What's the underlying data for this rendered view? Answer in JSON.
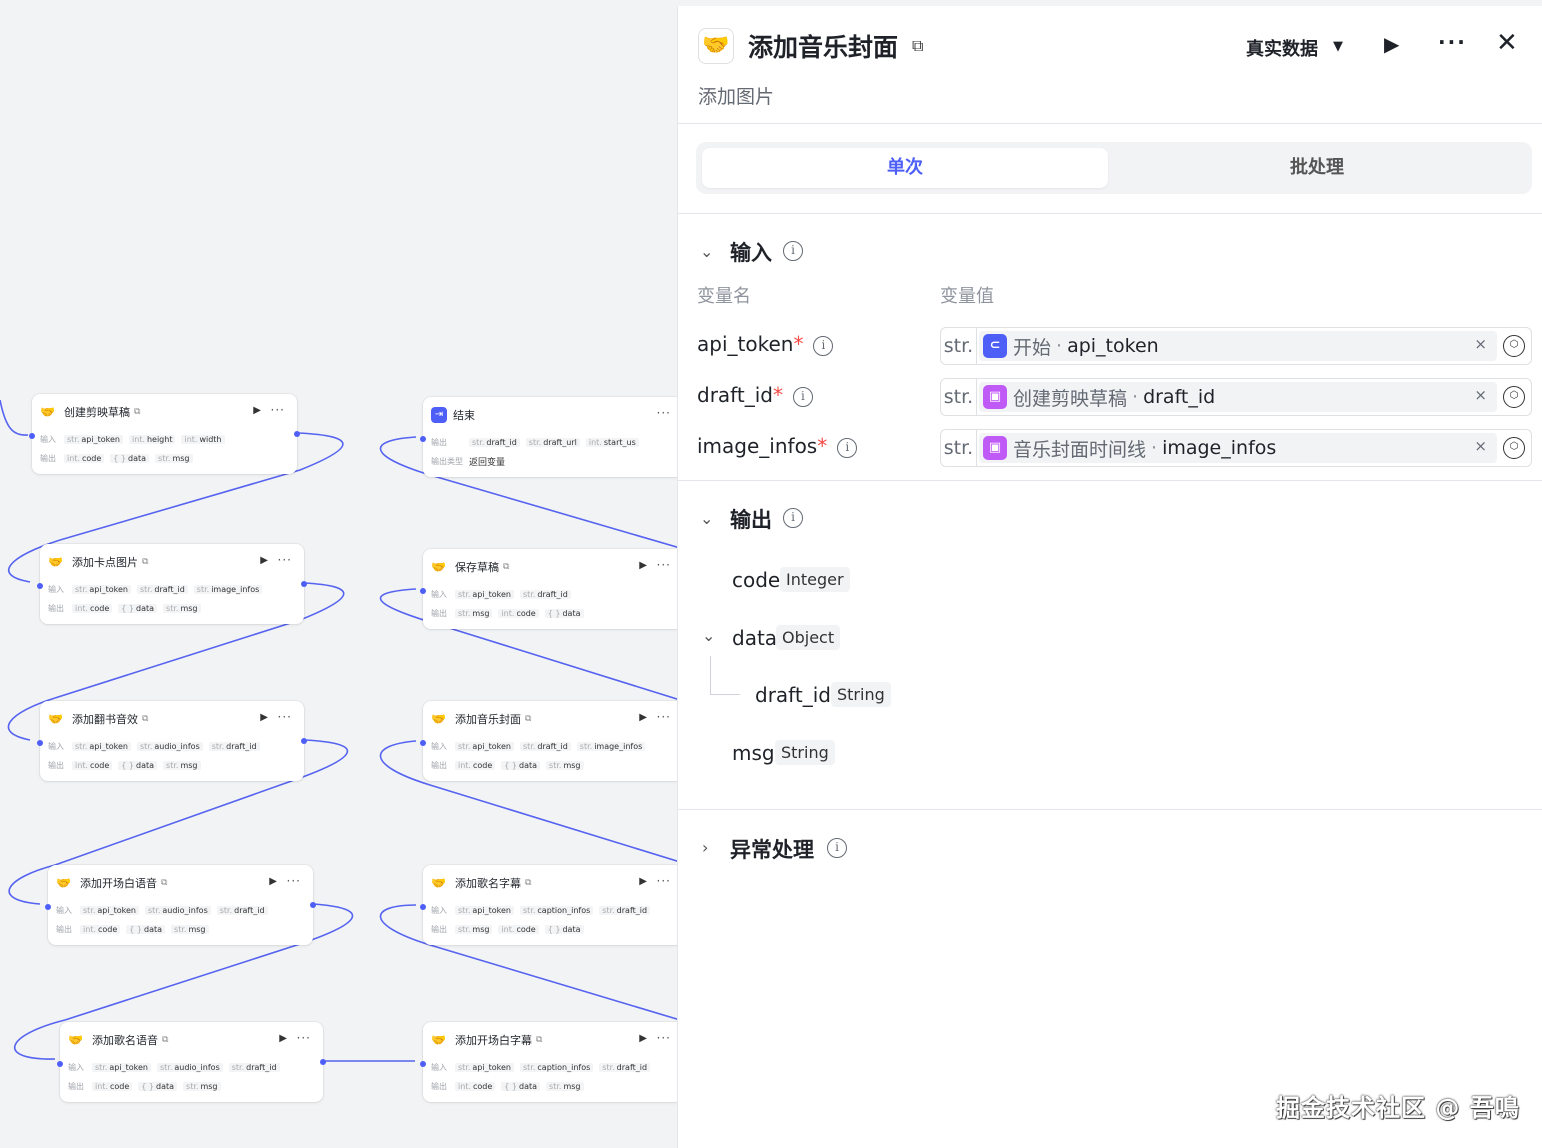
{
  "canvas": {
    "input_label": "输入",
    "output_label": "输出",
    "output_type_label": "输出类型",
    "nodes": [
      {
        "title": "创建剪映草稿",
        "inputs": [
          [
            "str.",
            "api_token"
          ],
          [
            "int.",
            "height"
          ],
          [
            "int.",
            "width"
          ]
        ],
        "outputs": [
          [
            "int.",
            "code"
          ],
          [
            "{ }",
            "data"
          ],
          [
            "str.",
            "msg"
          ]
        ]
      },
      {
        "title": "添加卡点图片",
        "inputs": [
          [
            "str.",
            "api_token"
          ],
          [
            "str.",
            "draft_id"
          ],
          [
            "str.",
            "image_infos"
          ]
        ],
        "outputs": [
          [
            "int.",
            "code"
          ],
          [
            "{ }",
            "data"
          ],
          [
            "str.",
            "msg"
          ]
        ]
      },
      {
        "title": "添加翻书音效",
        "inputs": [
          [
            "str.",
            "api_token"
          ],
          [
            "str.",
            "audio_infos"
          ],
          [
            "str.",
            "draft_id"
          ]
        ],
        "outputs": [
          [
            "int.",
            "code"
          ],
          [
            "{ }",
            "data"
          ],
          [
            "str.",
            "msg"
          ]
        ]
      },
      {
        "title": "添加开场白语音",
        "inputs": [
          [
            "str.",
            "api_token"
          ],
          [
            "str.",
            "audio_infos"
          ],
          [
            "str.",
            "draft_id"
          ]
        ],
        "outputs": [
          [
            "int.",
            "code"
          ],
          [
            "{ }",
            "data"
          ],
          [
            "str.",
            "msg"
          ]
        ]
      },
      {
        "title": "添加歌名语音",
        "inputs": [
          [
            "str.",
            "api_token"
          ],
          [
            "str.",
            "audio_infos"
          ],
          [
            "str.",
            "draft_id"
          ]
        ],
        "outputs": [
          [
            "int.",
            "code"
          ],
          [
            "{ }",
            "data"
          ],
          [
            "str.",
            "msg"
          ]
        ]
      },
      {
        "title": "结束",
        "inputs": [
          [
            "str.",
            "draft_id"
          ],
          [
            "str.",
            "draft_url"
          ],
          [
            "int.",
            "start_us"
          ]
        ],
        "return_text": "返回变量"
      },
      {
        "title": "保存草稿",
        "inputs": [
          [
            "str.",
            "api_token"
          ],
          [
            "str.",
            "draft_id"
          ]
        ],
        "outputs": [
          [
            "str.",
            "msg"
          ],
          [
            "int.",
            "code"
          ],
          [
            "{ }",
            "data"
          ]
        ]
      },
      {
        "title": "添加音乐封面",
        "inputs": [
          [
            "str.",
            "api_token"
          ],
          [
            "str.",
            "draft_id"
          ],
          [
            "str.",
            "image_infos"
          ]
        ],
        "outputs": [
          [
            "int.",
            "code"
          ],
          [
            "{ }",
            "data"
          ],
          [
            "str.",
            "msg"
          ]
        ]
      },
      {
        "title": "添加歌名字幕",
        "inputs": [
          [
            "str.",
            "api_token"
          ],
          [
            "str.",
            "caption_infos"
          ],
          [
            "str.",
            "draft_id"
          ]
        ],
        "outputs": [
          [
            "str.",
            "msg"
          ],
          [
            "int.",
            "code"
          ],
          [
            "{ }",
            "data"
          ]
        ]
      },
      {
        "title": "添加开场白字幕",
        "inputs": [
          [
            "str.",
            "api_token"
          ],
          [
            "str.",
            "caption_infos"
          ],
          [
            "str.",
            "draft_id"
          ]
        ],
        "outputs": [
          [
            "int.",
            "code"
          ],
          [
            "{ }",
            "data"
          ],
          [
            "str.",
            "msg"
          ]
        ]
      }
    ]
  },
  "panel": {
    "title": "添加音乐封面",
    "description": "添加图片",
    "mode_label": "真实数据",
    "tabs": {
      "single": "单次",
      "batch": "批处理"
    },
    "input_section": {
      "title": "输入",
      "col_name": "变量名",
      "col_value": "变量值",
      "rows": [
        {
          "name": "api_token",
          "required": "*",
          "type": "str.",
          "ref_node": "开始",
          "ref_var": "api_token",
          "ref_icon_color": "#4e5ff7",
          "ref_icon": "start-icon"
        },
        {
          "name": "draft_id",
          "required": "*",
          "type": "str.",
          "ref_node": "创建剪映草稿",
          "ref_var": "draft_id",
          "ref_icon_color": "#c05af7",
          "ref_icon": "plugin-cube-icon"
        },
        {
          "name": "image_infos",
          "required": "*",
          "type": "str.",
          "ref_node": "音乐封面时间线",
          "ref_var": "image_infos",
          "ref_icon_color": "#c05af7",
          "ref_icon": "plugin-cube-icon"
        }
      ]
    },
    "output_section": {
      "title": "输出",
      "fields": {
        "code": {
          "name": "code",
          "type": "Integer"
        },
        "data": {
          "name": "data",
          "type": "Object"
        },
        "draft_id": {
          "name": "draft_id",
          "type": "String"
        },
        "msg": {
          "name": "msg",
          "type": "String"
        }
      }
    },
    "error_section": {
      "title": "异常处理"
    }
  },
  "watermark": "掘金技术社区 @ 吾鳴"
}
